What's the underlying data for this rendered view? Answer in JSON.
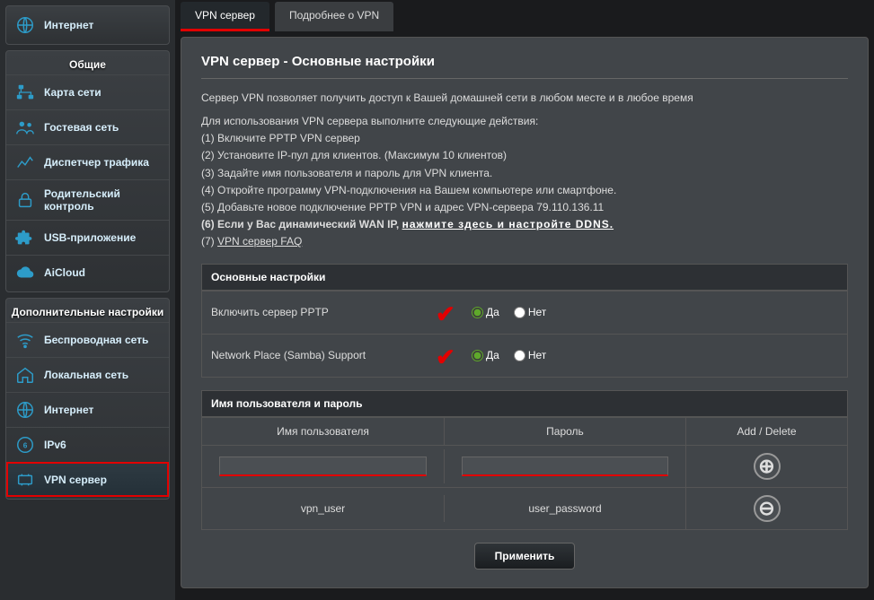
{
  "sidebar": {
    "internet_top": "Интернет",
    "group1_title": "Общие",
    "group1_items": [
      {
        "label": "Карта сети"
      },
      {
        "label": "Гостевая сеть"
      },
      {
        "label": "Диспетчер трафика"
      },
      {
        "label": "Родительский контроль"
      },
      {
        "label": "USB-приложение"
      },
      {
        "label": "AiCloud"
      }
    ],
    "group2_title": "Дополнительные настройки",
    "group2_items": [
      {
        "label": "Беспроводная сеть"
      },
      {
        "label": "Локальная сеть"
      },
      {
        "label": "Интернет"
      },
      {
        "label": "IPv6"
      },
      {
        "label": "VPN сервер"
      }
    ]
  },
  "tabs": [
    {
      "label": "VPN сервер",
      "active": true
    },
    {
      "label": "Подробнее о VPN",
      "active": false
    }
  ],
  "panel": {
    "title": "VPN сервер - Основные настройки",
    "intro": "Сервер VPN позволяет получить доступ к Вашей домашней сети в любом месте и в любое время",
    "steps_intro": "Для использования VPN сервера выполните следующие действия:",
    "step1": "(1) Включите PPTP VPN сервер",
    "step2": "(2) Установите IP-пул для клиентов. (Максимум 10 клиентов)",
    "step3": "(3) Задайте имя пользователя и пароль для VPN клиента.",
    "step4": "(4) Откройте программу VPN-подключения на Вашем компьютере или смартфоне.",
    "step5": "(5) Добавьте новое подключение PPTP VPN и адрес VPN-сервера 79.110.136.11",
    "step6_prefix": "(6) Если у Вас динамический WAN IP, ",
    "step6_link": "нажмите здесь и настройте DDNS.",
    "step7_prefix": "(7) ",
    "step7_link": "VPN сервер FAQ",
    "section_basic": "Основные настройки",
    "row_pptp": "Включить сервер PPTP",
    "row_samba": "Network Place (Samba) Support",
    "radio_yes": "Да",
    "radio_no": "Нет",
    "section_userpass": "Имя пользователя и пароль",
    "col_user": "Имя пользователя",
    "col_pass": "Пароль",
    "col_action": "Add / Delete",
    "sample_user": "vpn_user",
    "sample_pass": "user_password",
    "apply": "Применить"
  }
}
